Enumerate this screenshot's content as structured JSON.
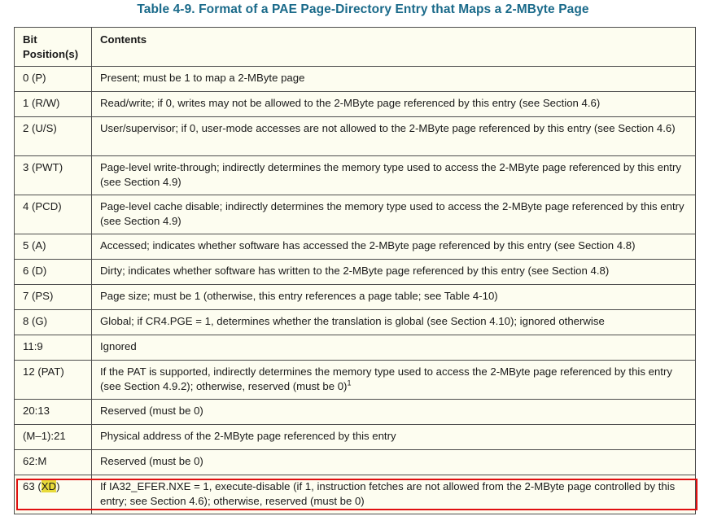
{
  "title": "Table 4-9.  Format of a PAE Page-Directory Entry that Maps a 2-MByte Page",
  "headers": {
    "bit_line1": "Bit",
    "bit_line2": "Position(s)",
    "contents": "Contents"
  },
  "rows": [
    {
      "bit": "0 (P)",
      "contents": "Present; must be 1 to map a 2-MByte page"
    },
    {
      "bit": "1 (R/W)",
      "contents": "Read/write; if 0, writes may not be allowed to the 2-MByte page referenced by this entry (see Section 4.6)"
    },
    {
      "bit": "2 (U/S)",
      "contents": "User/supervisor; if 0, user-mode accesses are not allowed to the 2-MByte page referenced by this entry (see Section 4.6)"
    },
    {
      "bit": "3 (PWT)",
      "contents": "Page-level write-through; indirectly determines the memory type used to access the 2-MByte page referenced by this entry (see Section 4.9)"
    },
    {
      "bit": "4 (PCD)",
      "contents": "Page-level cache disable; indirectly determines the memory type used to access the 2-MByte page referenced by this entry (see Section 4.9)"
    },
    {
      "bit": "5 (A)",
      "contents": "Accessed; indicates whether software has accessed the 2-MByte page referenced by this entry (see Section 4.8)"
    },
    {
      "bit": "6 (D)",
      "contents": "Dirty; indicates whether software has written to the 2-MByte page referenced by this entry (see Section 4.8)"
    },
    {
      "bit": "7 (PS)",
      "contents": "Page size; must be 1 (otherwise, this entry references a page table; see Table 4-10)"
    },
    {
      "bit": "8 (G)",
      "contents": "Global; if CR4.PGE = 1, determines whether the translation is global (see Section 4.10); ignored otherwise"
    },
    {
      "bit": "11:9",
      "contents": "Ignored"
    },
    {
      "bit": "12 (PAT)",
      "contents": "If the PAT is supported, indirectly determines the memory type used to access the 2-MByte page referenced by this entry (see Section 4.9.2); otherwise, reserved (must be 0)",
      "footnote": "1"
    },
    {
      "bit": "20:13",
      "contents": "Reserved (must be 0)"
    },
    {
      "bit": "(M–1):21",
      "contents": "Physical address of the 2-MByte page referenced by this entry"
    },
    {
      "bit": "62:M",
      "contents": "Reserved (must be 0)"
    },
    {
      "bit_prefix": "63 (",
      "bit_highlight": "XD",
      "bit_suffix": ")",
      "contents": "If IA32_EFER.NXE = 1, execute-disable (if 1, instruction fetches are not allowed from the 2-MByte page controlled by this entry; see Section 4.6); otherwise, reserved (must be 0)"
    }
  ],
  "colors": {
    "title": "#1a6a8a",
    "table_background": "#fdfdf0",
    "highlight": "#e8da3a",
    "annotation_box": "#e01010"
  }
}
